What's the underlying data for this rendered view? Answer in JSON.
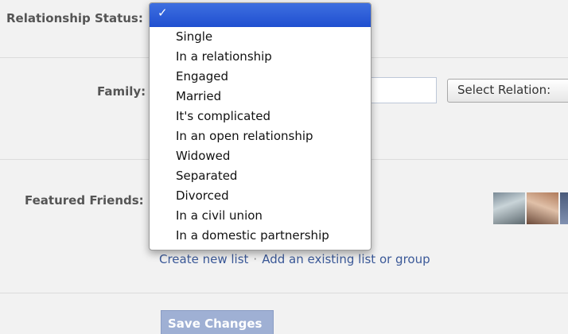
{
  "form": {
    "relationship_status_label": "Relationship Status:",
    "family_label": "Family:",
    "featured_friends_label": "Featured Friends:",
    "select_relation_label": "Select Relation:",
    "create_new_list_link": "Create new list",
    "link_separator": "·",
    "add_existing_list_link": "Add an existing list or group",
    "save_changes_button": "Save Changes"
  },
  "dropdown": {
    "selected_check": "✓",
    "options": [
      "Single",
      "In a relationship",
      "Engaged",
      "Married",
      "It's complicated",
      "In an open relationship",
      "Widowed",
      "Separated",
      "Divorced",
      "In a civil union",
      "In a domestic partnership"
    ]
  },
  "colors": {
    "link": "#3b5998",
    "highlight": "#2a5ad6",
    "save_button_bg": "#9fb0d4"
  }
}
